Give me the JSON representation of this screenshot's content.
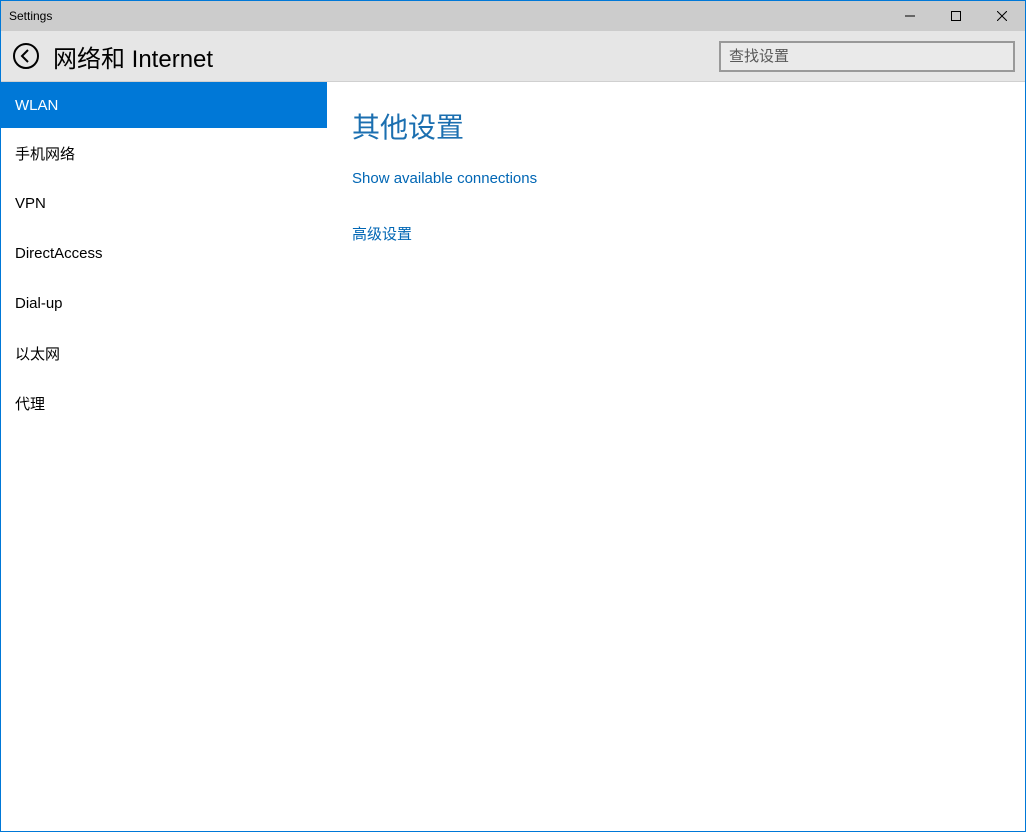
{
  "window": {
    "title": "Settings"
  },
  "header": {
    "page_title": "网络和 Internet",
    "search_placeholder": "查找设置"
  },
  "sidebar": {
    "items": [
      {
        "label": "WLAN",
        "active": true
      },
      {
        "label": "手机网络",
        "active": false
      },
      {
        "label": "VPN",
        "active": false
      },
      {
        "label": "DirectAccess",
        "active": false
      },
      {
        "label": "Dial-up",
        "active": false
      },
      {
        "label": "以太网",
        "active": false
      },
      {
        "label": "代理",
        "active": false
      }
    ]
  },
  "content": {
    "heading": "其他设置",
    "links": [
      {
        "label": "Show available connections"
      },
      {
        "label": "高级设置"
      }
    ]
  }
}
